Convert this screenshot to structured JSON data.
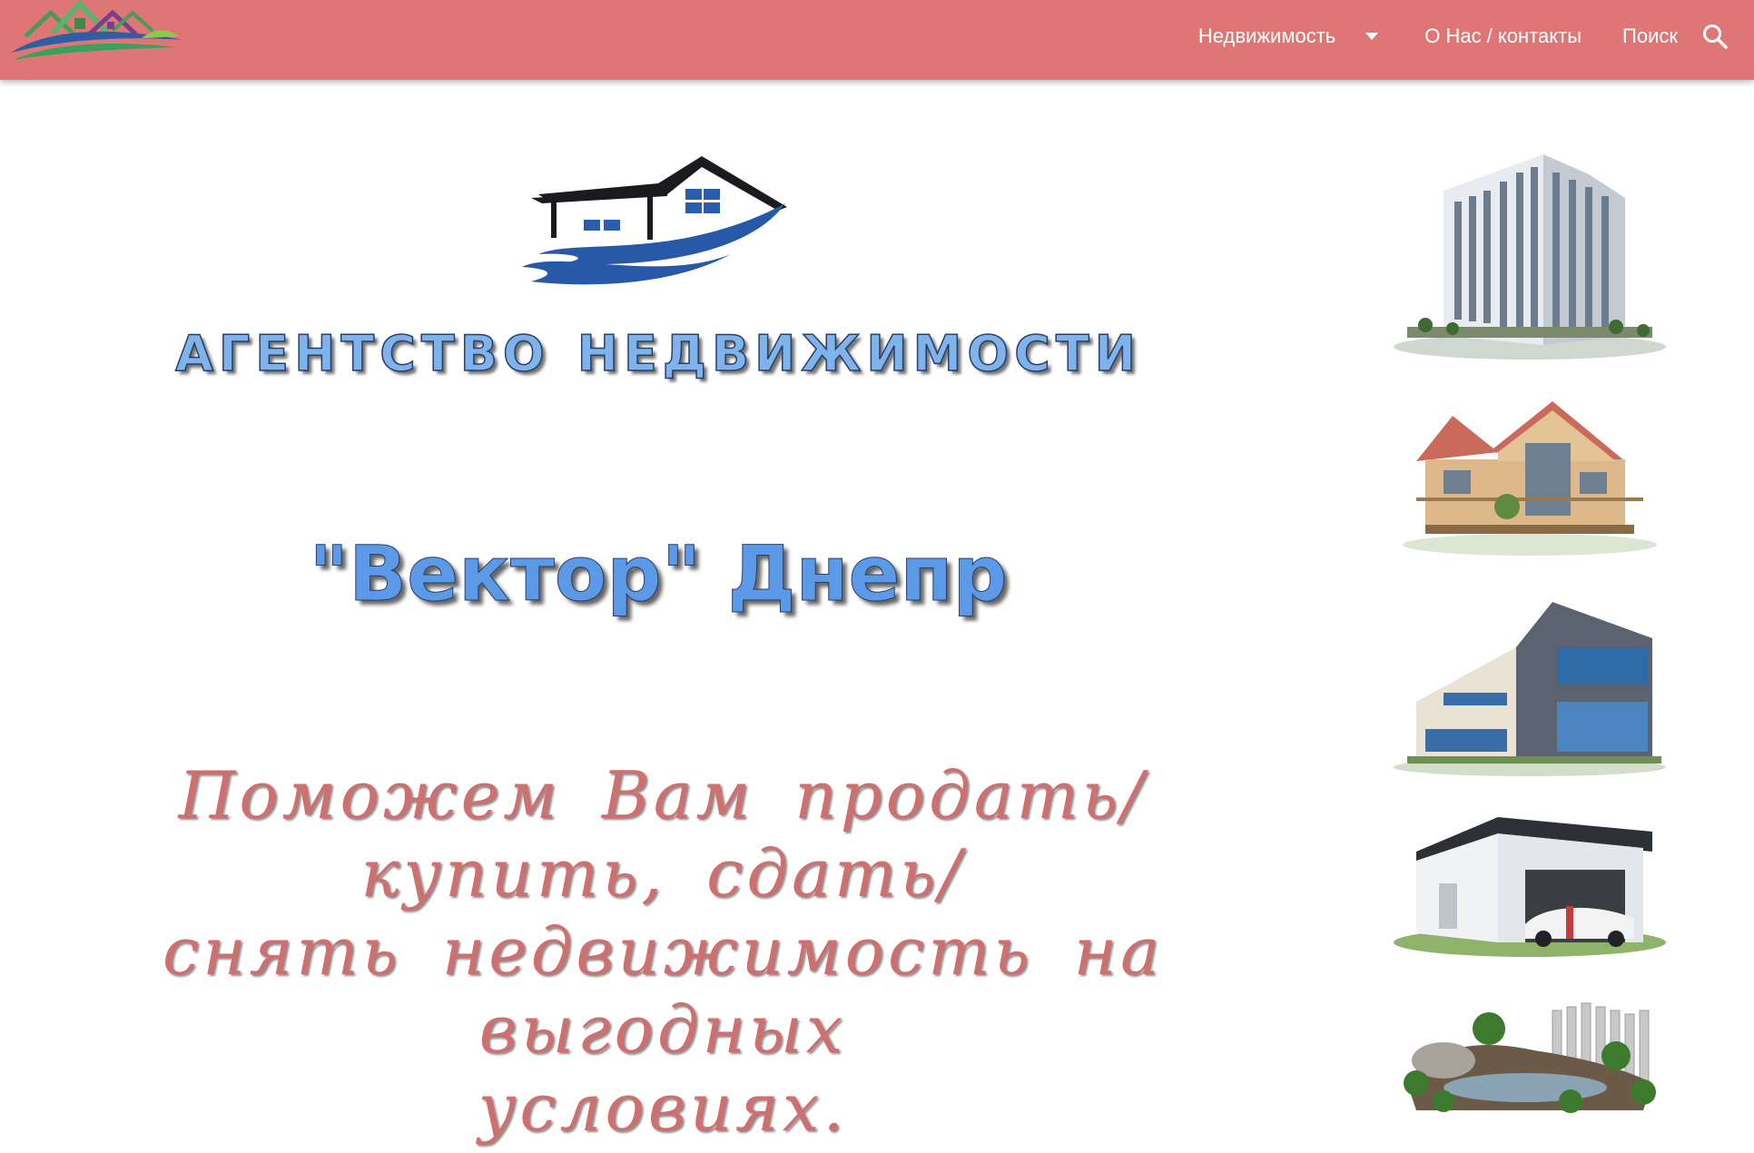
{
  "nav": {
    "realty_label": "Недвижимость",
    "about_label": "О Нас / контакты",
    "search_label": "Поиск"
  },
  "hero": {
    "agency_title_word1": "АГЕНТСТВО",
    "agency_title_word2": "НЕДВИЖИМОСТИ",
    "brand_name": "\"Вектор\" Днепр",
    "tagline_line1": "Поможем Вам продать/купить, сдать/",
    "tagline_line2": "снять недвижимость на выгодных",
    "tagline_line3": "условиях."
  },
  "side_images": [
    {
      "name": "highrise-building-image"
    },
    {
      "name": "cottage-house-image"
    },
    {
      "name": "commercial-building-image"
    },
    {
      "name": "garage-image"
    },
    {
      "name": "land-plot-image"
    }
  ],
  "colors": {
    "topbar": "#df7676",
    "title_blue": "#7eb3ec",
    "brand_blue": "#5c9ae8",
    "tagline_red": "#cf7070",
    "logo_navy": "#24589f"
  },
  "icons": [
    "site-logo-icon",
    "chevron-down-icon",
    "search-icon",
    "agency-house-logo"
  ]
}
